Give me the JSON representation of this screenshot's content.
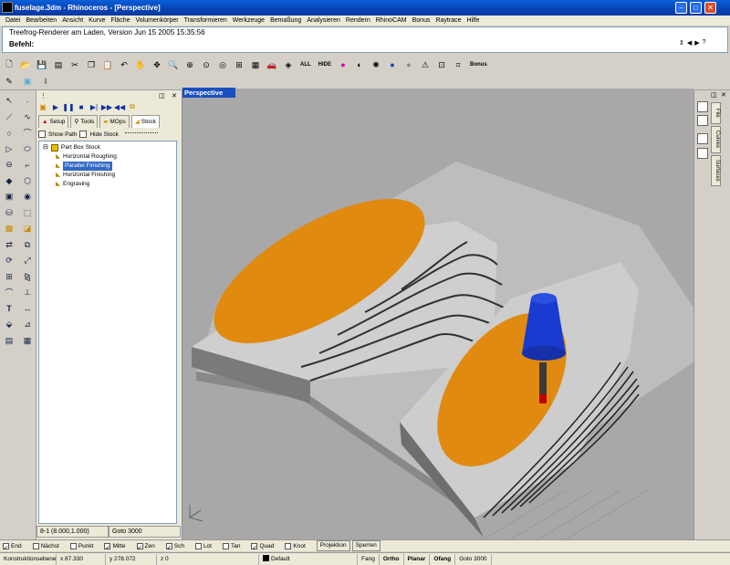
{
  "window": {
    "title": "fuselage.3dm - Rhinoceros - [Perspective]",
    "min": "‒",
    "max": "□",
    "close": "✕"
  },
  "menu": [
    "Datei",
    "Bearbeiten",
    "Ansicht",
    "Kurve",
    "Fläche",
    "Volumenkörper",
    "Transformieren",
    "Werkzeuge",
    "Bemaßung",
    "Analysieren",
    "Rendern",
    "RhinoCAM",
    "Bonus",
    "Raytrace",
    "Hilfe"
  ],
  "command": {
    "history": "Treefrog-Renderer am Laden, Version Jun 15 2005 15:35:56",
    "prompt": "Befehl:",
    "value": ""
  },
  "toolbar": {
    "all_label": "ALL",
    "hide_label": "HIDE",
    "bonus_label": "Bonus"
  },
  "panel": {
    "tabs": [
      "Setup",
      "Tools",
      "MOps",
      "Stock"
    ],
    "show_path": "Show Path",
    "hide_stock": "Hide Stock",
    "tree_root": "Part Box Stock",
    "tree_items": [
      "Horizontal Roughing",
      "Parallel Finishing",
      "Horizontal Finishing",
      "Engraving"
    ],
    "selected_index": 1,
    "status_left": "8-1 (8.000,1.000)",
    "status_right": "Goto 3000"
  },
  "viewport": {
    "title": "Perspective"
  },
  "right_tabs": [
    "File",
    "Curves",
    "Surfaces"
  ],
  "osnap": [
    {
      "label": "End",
      "checked": true
    },
    {
      "label": "Nächst",
      "checked": false
    },
    {
      "label": "Punkt",
      "checked": false
    },
    {
      "label": "Mitte",
      "checked": true
    },
    {
      "label": "Zen",
      "checked": true
    },
    {
      "label": "Sch",
      "checked": true
    },
    {
      "label": "Lot",
      "checked": false
    },
    {
      "label": "Tan",
      "checked": false
    },
    {
      "label": "Quad",
      "checked": true
    },
    {
      "label": "Knot",
      "checked": false
    }
  ],
  "osnap_buttons": [
    "Projektion",
    "Sperren"
  ],
  "status": {
    "cplane": "Konstruktionsebene",
    "x": "x 87.330",
    "y": "y 278.072",
    "z": "z 0",
    "layer": "Default",
    "snap": "Fang",
    "ortho": "Ortho",
    "planar": "Planar",
    "osnap": "Ofang",
    "goto": "Goto 3000"
  },
  "colors": {
    "title_bar": "#0842b4",
    "viewport_bg": "#a8a8a8",
    "part_orange": "#e08a10",
    "tool_blue": "#1a3bd0",
    "selection": "#316ac5"
  }
}
